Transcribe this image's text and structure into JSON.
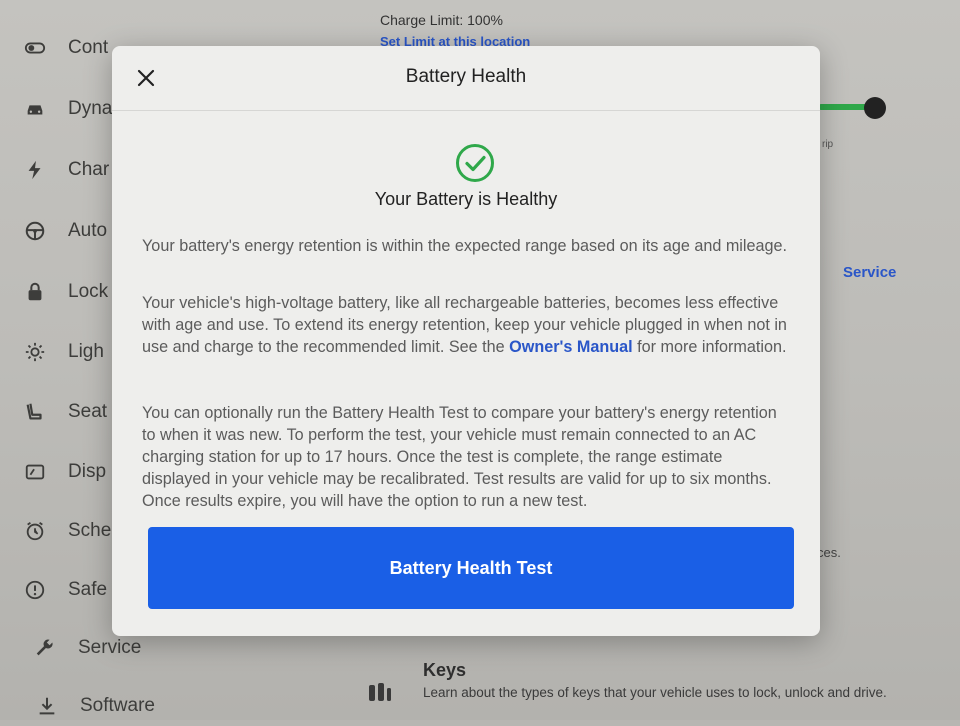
{
  "sidebar": {
    "items": [
      {
        "label": "Cont",
        "icon": "toggle-icon"
      },
      {
        "label": "Dyna",
        "icon": "car-icon"
      },
      {
        "label": "Char",
        "icon": "lightning-icon"
      },
      {
        "label": "Auto",
        "icon": "steering-wheel-icon"
      },
      {
        "label": "Lock",
        "icon": "lock-icon"
      },
      {
        "label": "Ligh",
        "icon": "sun-icon"
      },
      {
        "label": "Seat",
        "icon": "seat-icon"
      },
      {
        "label": "Disp",
        "icon": "display-icon"
      },
      {
        "label": "Sche",
        "icon": "alarm-clock-icon"
      },
      {
        "label": "Safe",
        "icon": "info-circle-icon"
      },
      {
        "label": "Service",
        "icon": "wrench-icon"
      },
      {
        "label": "Software",
        "icon": "download-icon"
      }
    ]
  },
  "background": {
    "charge_limit": "Charge Limit: 100%",
    "set_limit_link": "Set Limit at this location",
    "trip_text": "rip",
    "service_link": "Service",
    "ces_text": "ces.",
    "keys_title": "Keys",
    "keys_desc": "Learn about the types of keys that your vehicle uses to lock, unlock and drive."
  },
  "modal": {
    "title": "Battery Health",
    "status_title": "Your Battery is Healthy",
    "paragraph1": "Your battery's energy retention is within the expected range based on its age and mileage.",
    "paragraph2_before_link": "Your vehicle's high-voltage battery, like all rechargeable batteries, becomes less effective with age and use. To extend its energy retention, keep your vehicle plugged in when not in use and charge to the recommended limit. See the ",
    "paragraph2_link": "Owner's Manual",
    "paragraph2_after_link": " for more information.",
    "paragraph3": "You can optionally run the Battery Health Test to compare your battery's energy retention to when it was new. To perform the test, your vehicle must remain connected to an AC charging station for up to 17 hours. Once the test is complete, the range estimate displayed in your vehicle may be recalibrated. Test results are valid for up to six months. Once results expire, you will have the option to run a new test.",
    "test_button_label": "Battery Health Test"
  },
  "colors": {
    "accent_blue": "#1a5fe6",
    "link_blue": "#2a56c8",
    "healthy_green": "#2fa84a"
  }
}
